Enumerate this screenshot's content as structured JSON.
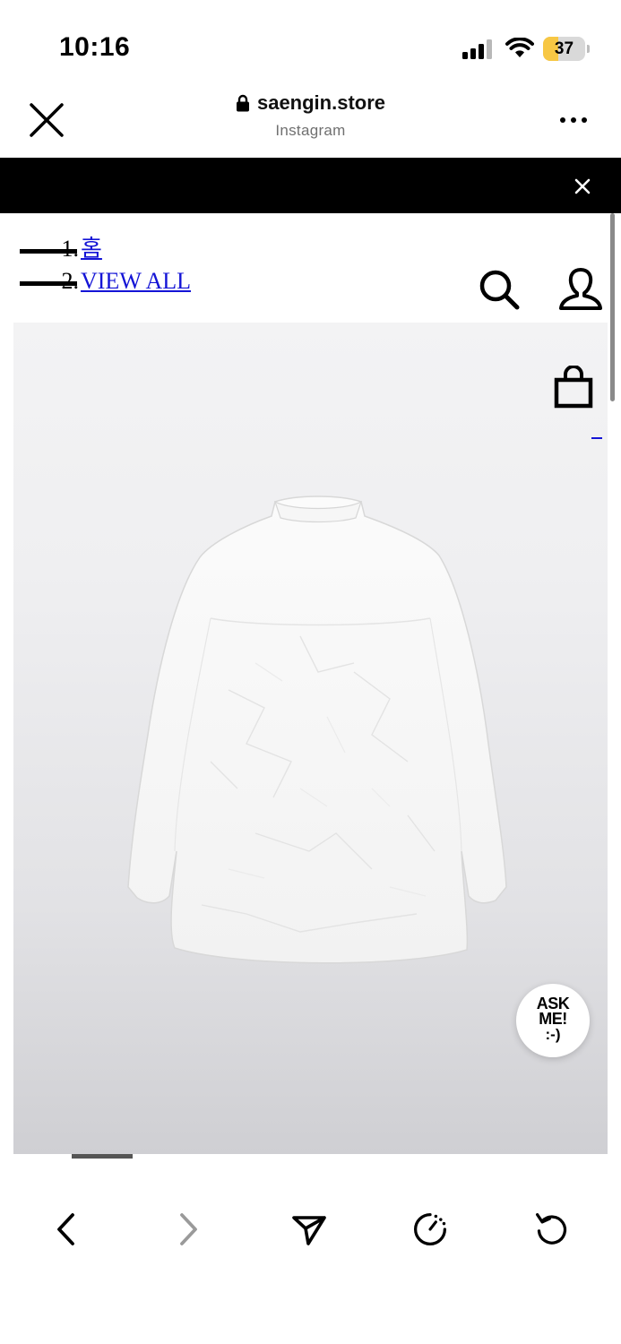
{
  "status_bar": {
    "time": "10:16",
    "battery_level": "37",
    "battery_fraction": 0.37,
    "icons": [
      "signal-icon",
      "wifi-icon",
      "battery-icon"
    ]
  },
  "browser": {
    "url": "saengin.store",
    "source": "Instagram",
    "icons": [
      "close-icon",
      "lock-icon",
      "more-icon"
    ]
  },
  "banner": {
    "icons": [
      "close-icon"
    ]
  },
  "breadcrumb": [
    {
      "number": "1.",
      "label": "홈"
    },
    {
      "number": "2.",
      "label": "VIEW ALL"
    }
  ],
  "header_icons": [
    "search-icon",
    "user-icon",
    "shopping-bag-icon"
  ],
  "chat_button": {
    "line1": "ASK",
    "line2": "ME!",
    "line3": ":-)"
  },
  "toolbar": {
    "icons": [
      "back-icon",
      "forward-icon",
      "share-icon",
      "timer-icon",
      "reload-icon"
    ]
  },
  "colors": {
    "link": "#1414d6",
    "banner": "#000000",
    "battery": "#f7c744"
  }
}
